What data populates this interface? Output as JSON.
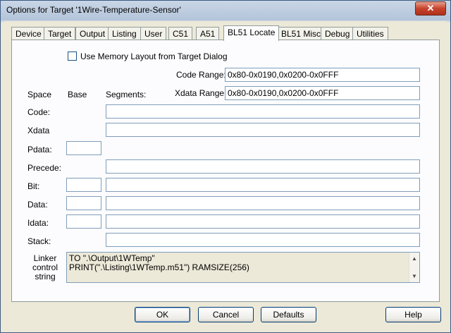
{
  "window": {
    "title": "Options for Target '1Wire-Temperature-Sensor'",
    "close_label": "✕"
  },
  "tabs": [
    {
      "label": "Device"
    },
    {
      "label": "Target"
    },
    {
      "label": "Output"
    },
    {
      "label": "Listing"
    },
    {
      "label": "User"
    },
    {
      "label": "C51"
    },
    {
      "label": "A51"
    },
    {
      "label": "BL51 Locate"
    },
    {
      "label": "BL51 Misc"
    },
    {
      "label": "Debug"
    },
    {
      "label": "Utilities"
    }
  ],
  "panel": {
    "use_memory_layout": {
      "label": "Use Memory Layout from Target Dialog",
      "checked": false
    },
    "code_range": {
      "label": "Code Range:",
      "value": "0x80-0x0190,0x0200-0x0FFF"
    },
    "xdata_range": {
      "label": "Xdata Range:",
      "value": "0x80-0x0190,0x0200-0x0FFF"
    },
    "headers": {
      "space": "Space",
      "base": "Base",
      "segments": "Segments:"
    },
    "rows": [
      {
        "label": "Code:",
        "base": null,
        "segments": ""
      },
      {
        "label": "Xdata",
        "base": null,
        "segments": ""
      },
      {
        "label": "Pdata:",
        "base": "",
        "segments": null
      },
      {
        "label": "Precede:",
        "base": null,
        "segments": ""
      },
      {
        "label": "Bit:",
        "base": "",
        "segments": ""
      },
      {
        "label": "Data:",
        "base": "",
        "segments": ""
      },
      {
        "label": "Idata:",
        "base": "",
        "segments": ""
      },
      {
        "label": "Stack:",
        "base": null,
        "segments": ""
      }
    ],
    "linker": {
      "label_line1": "Linker",
      "label_line2": "control",
      "label_line3": "string",
      "line1": "TO \".\\Output\\1WTemp\"",
      "line2": "PRINT(\".\\Listing\\1WTemp.m51\") RAMSIZE(256)"
    }
  },
  "buttons": {
    "ok": "OK",
    "cancel": "Cancel",
    "defaults": "Defaults",
    "help": "Help"
  }
}
